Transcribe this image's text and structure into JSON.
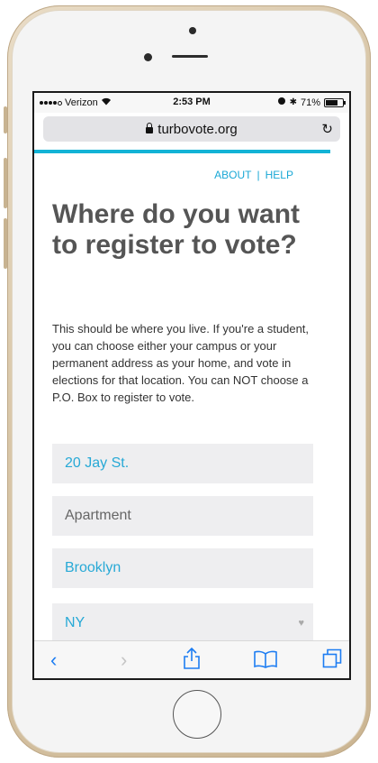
{
  "status": {
    "carrier": "Verizon",
    "time": "2:53 PM",
    "battery_text": "71%",
    "battery_level": 0.71
  },
  "browser": {
    "url": "turbovote.org",
    "load_progress": 0.94
  },
  "nav": {
    "about": "ABOUT",
    "separator": "|",
    "help": "HELP"
  },
  "page": {
    "heading": "Where do you want to register to vote?",
    "intro": "This should be where you live. If you're a student, you can choose either your campus or your permanent address as your home, and vote in elections for that location. You can NOT choose a P.O. Box to register to vote."
  },
  "form": {
    "street": "20 Jay St.",
    "apartment_placeholder": "Apartment",
    "city": "Brooklyn",
    "state": "NY"
  },
  "toolbar": {
    "icons": [
      "back-icon",
      "forward-icon",
      "share-icon",
      "bookmarks-icon",
      "tabs-icon"
    ]
  },
  "colors": {
    "accent": "#27a9d6",
    "ios_blue": "#1d7df2",
    "heading": "#555555"
  }
}
